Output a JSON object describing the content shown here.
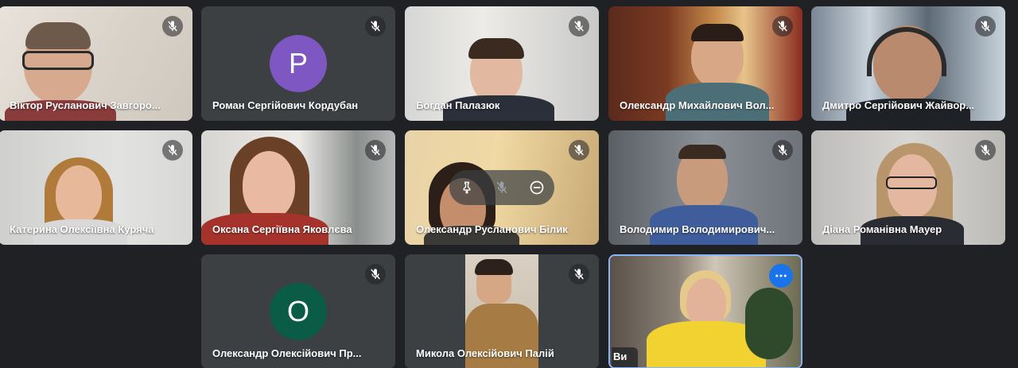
{
  "participants": [
    {
      "name": "Віктор Русланович Завгородній",
      "display": "Віктор Русланович Завгоро...",
      "muted": true
    },
    {
      "name": "Роман Сергійович Кордубан",
      "display": "Роман Сергійович Кордубан",
      "muted": true,
      "avatar_letter": "P",
      "avatar_color": "#7e57c2"
    },
    {
      "name": "Богдан Палазюк",
      "display": "Богдан Палазюк",
      "muted": true
    },
    {
      "name": "Олександр Михайлович Волошин",
      "display": "Олександр Михайлович Вол...",
      "muted": true
    },
    {
      "name": "Дмитро Сергійович Жайворонок",
      "display": "Дмитро Сергійович Жайвор...",
      "muted": true
    },
    {
      "name": "Катерина Олексіївна Куряча",
      "display": "Катерина Олексіївна Куряча",
      "muted": true
    },
    {
      "name": "Оксана Сергіївна Яковлєва",
      "display": "Оксана Сергіївна Яковлєва",
      "muted": true
    },
    {
      "name": "Олександр Русланович Білик",
      "display": "Олександр Русланович Білик",
      "muted": true
    },
    {
      "name": "Володимир Володимирович",
      "display": "Володимир Володимирович...",
      "muted": true
    },
    {
      "name": "Діана Романівна Мауер",
      "display": "Діана Романівна Мауер",
      "muted": true
    },
    {
      "name": "Олександр Олексійович Прокопенко",
      "display": "Олександр Олексійович Пр...",
      "muted": true,
      "avatar_letter": "O",
      "avatar_color": "#0b5c47"
    },
    {
      "name": "Микола Олексійович Палій",
      "display": "Микола Олексійович Палій",
      "muted": true
    }
  ],
  "self": {
    "label": "Ви"
  },
  "colors": {
    "background": "#202124",
    "tile": "#3c4043",
    "accent": "#8ab4f8",
    "more_button": "#1a73e8"
  },
  "hover_controls": [
    "pin-icon",
    "mute-icon",
    "remove-icon"
  ]
}
